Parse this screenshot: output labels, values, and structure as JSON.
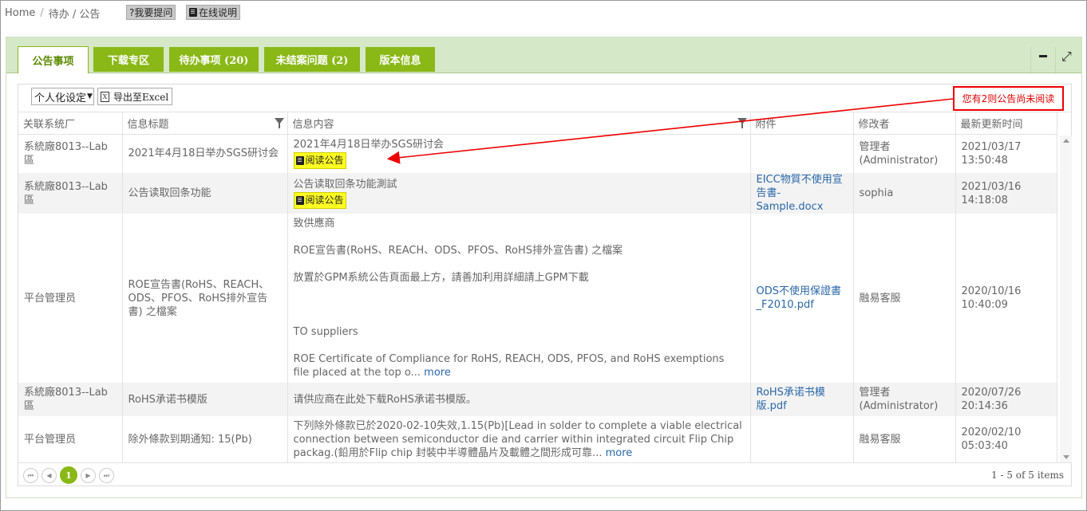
{
  "breadcrumb": {
    "home": "Home",
    "sep": "/",
    "path": "待办 / 公告"
  },
  "topbar": {
    "help_label": "?我要提问",
    "manual_label": "在线说明"
  },
  "tabs": [
    {
      "label": "公告事项"
    },
    {
      "label": "下载专区"
    },
    {
      "label": "待办事项 (20)"
    },
    {
      "label": "未结案问题 (2)"
    },
    {
      "label": "版本信息"
    }
  ],
  "toolbar": {
    "personalize_label": "个人化设定",
    "export_label": "导出至Excel",
    "excel_icon_glyph": "X"
  },
  "notice": {
    "text": "您有2则公告尚未阅读"
  },
  "columns": [
    "关联系统厂",
    "信息标题",
    "信息内容",
    "附件",
    "修改者",
    "最新更新时间"
  ],
  "rows": [
    {
      "system": "系統廠8013--Lab區",
      "title": "2021年4月18日举办SGS研讨会",
      "content": [
        "2021年4月18日举办SGS研讨会"
      ],
      "read_button": "阅读公告",
      "attachment": "",
      "modifier": "管理者\n(Administrator)",
      "updated": "2021/03/17\n13:50:48"
    },
    {
      "system": "系統廠8013--Lab區",
      "title": "公告读取回条功能",
      "content": [
        "公告读取回条功能測試"
      ],
      "read_button": "阅读公告",
      "attachment": "EICC物質不使用宣告書-Sample.docx",
      "modifier": "sophia",
      "updated": "2021/03/16\n14:18:08"
    },
    {
      "system": "平台管理员",
      "title": "ROE宣告書(RoHS、REACH、ODS、PFOS、RoHS排外宣告書) 之檔案",
      "content_lines": {
        "l1": "致供應商",
        "l2": "ROE宣告書(RoHS、REACH、ODS、PFOS、RoHS排外宣告書) 之檔案",
        "l3": "放置於GPM系統公告頁面最上方，請善加利用詳細請上GPM下載",
        "l4": "TO  suppliers",
        "l5": "ROE Certificate of Compliance for RoHS, REACH, ODS, PFOS, and RoHS exemptions",
        "l6": "file placed at the top o..."
      },
      "more": "more",
      "attachment": "ODS不使用保證書_F2010.pdf",
      "modifier": "融易客服",
      "updated": "2020/10/16\n10:40:09"
    },
    {
      "system": "系統廠8013--Lab區",
      "title": "RoHS承诺书模版",
      "content": [
        "请供应商在此处下载RoHS承诺书模版。"
      ],
      "attachment": "RoHS承诺书模版.pdf",
      "modifier": "管理者\n(Administrator)",
      "updated": "2020/07/26\n20:14:36"
    },
    {
      "system": "平台管理员",
      "title": "除外條款到期通知: 15(Pb)",
      "content_text": "下列除外條款已於2020-02-10失效,1.15(Pb)[Lead in solder to complete a viable electrical connection between semiconductor die and carrier within integrated circuit Flip Chip packag.(鉛用於Flip chip 封裝中半導體晶片及載體之間形成可靠...",
      "more": "more",
      "attachment": "",
      "modifier": "融易客服",
      "updated": "2020/02/10\n05:03:40"
    }
  ],
  "pager": {
    "current_page": "1",
    "info": "1 - 5 of 5 items"
  },
  "colors": {
    "tab_green": "#8ab817",
    "tabbar_bg": "#d5e8c7",
    "link": "#2a67a8",
    "highlight": "#ffff22",
    "annotation_red": "#e00000"
  }
}
